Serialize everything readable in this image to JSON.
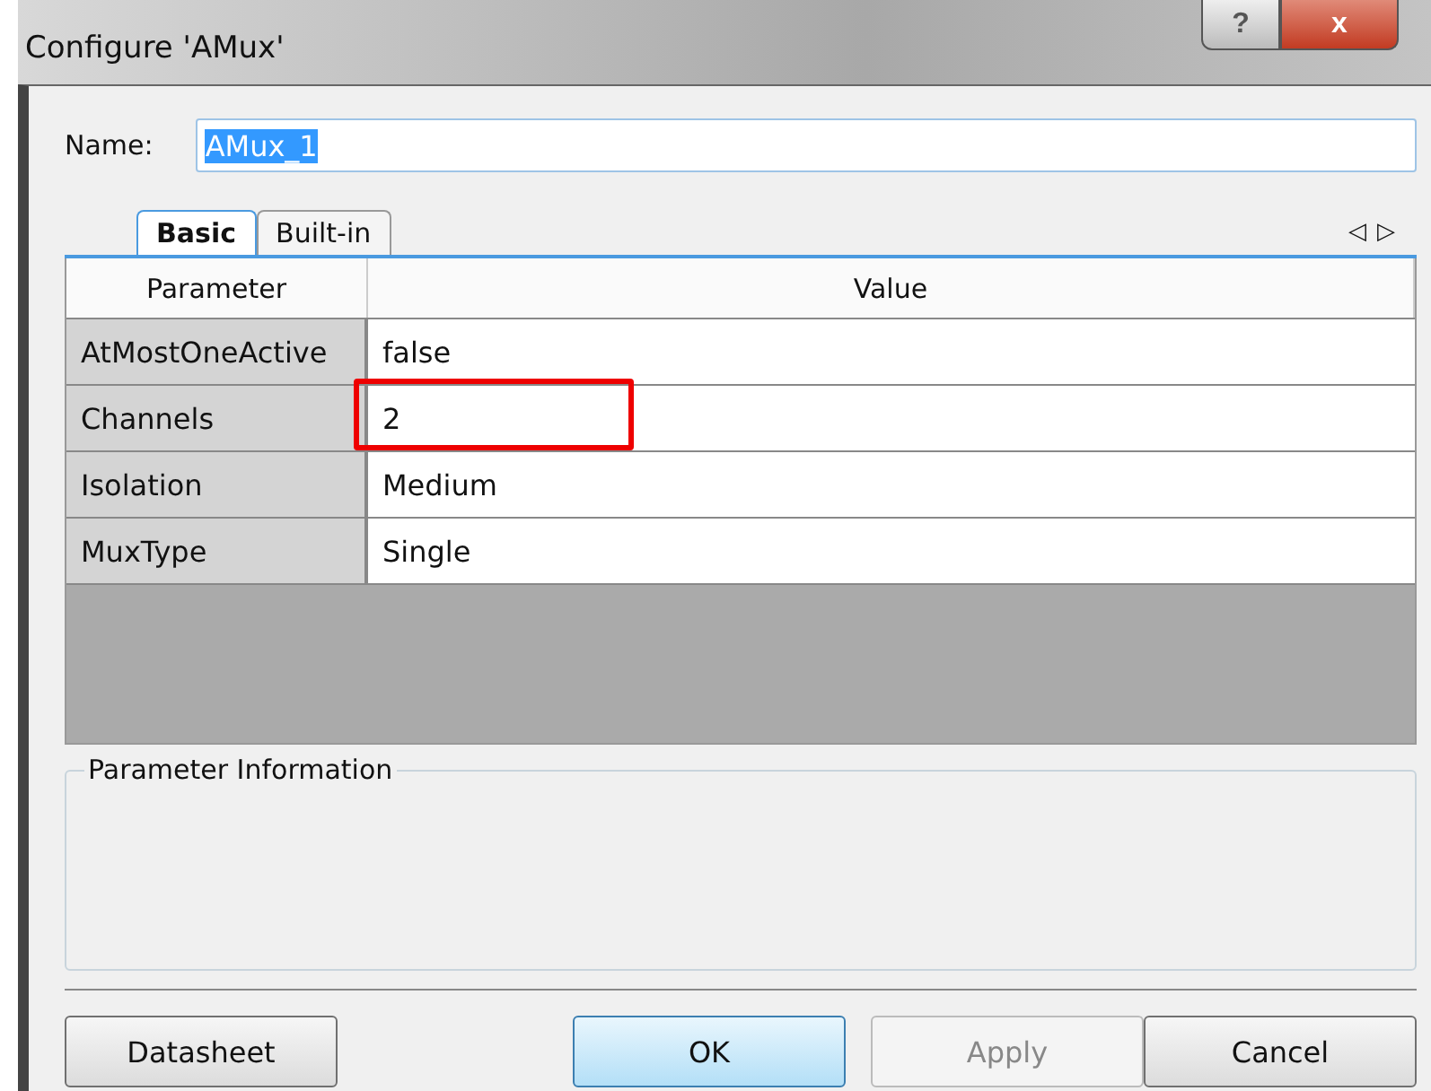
{
  "window": {
    "title": "Configure 'AMux'",
    "controls": [
      "?",
      "x"
    ]
  },
  "name_field": {
    "label": "Name:",
    "value": "AMux_1"
  },
  "tabs": [
    {
      "label": "Basic",
      "selected": true
    },
    {
      "label": "Built-in",
      "selected": false
    }
  ],
  "tab_scroll": [
    "◁",
    "▷"
  ],
  "table": {
    "columns": [
      "Parameter",
      "Value"
    ],
    "rows": [
      {
        "parameter": "AtMostOneActive",
        "value": "false",
        "highlighted": false
      },
      {
        "parameter": "Channels",
        "value": "2",
        "highlighted": true
      },
      {
        "parameter": "Isolation",
        "value": "Medium",
        "highlighted": false
      },
      {
        "parameter": "MuxType",
        "value": "Single",
        "highlighted": false
      }
    ]
  },
  "info_group": {
    "title": "Parameter Information"
  },
  "buttons": [
    {
      "label": "Datasheet",
      "kind": "normal"
    },
    {
      "label": "OK",
      "kind": "default"
    },
    {
      "label": "Apply",
      "kind": "disabled"
    },
    {
      "label": "Cancel",
      "kind": "normal"
    }
  ]
}
